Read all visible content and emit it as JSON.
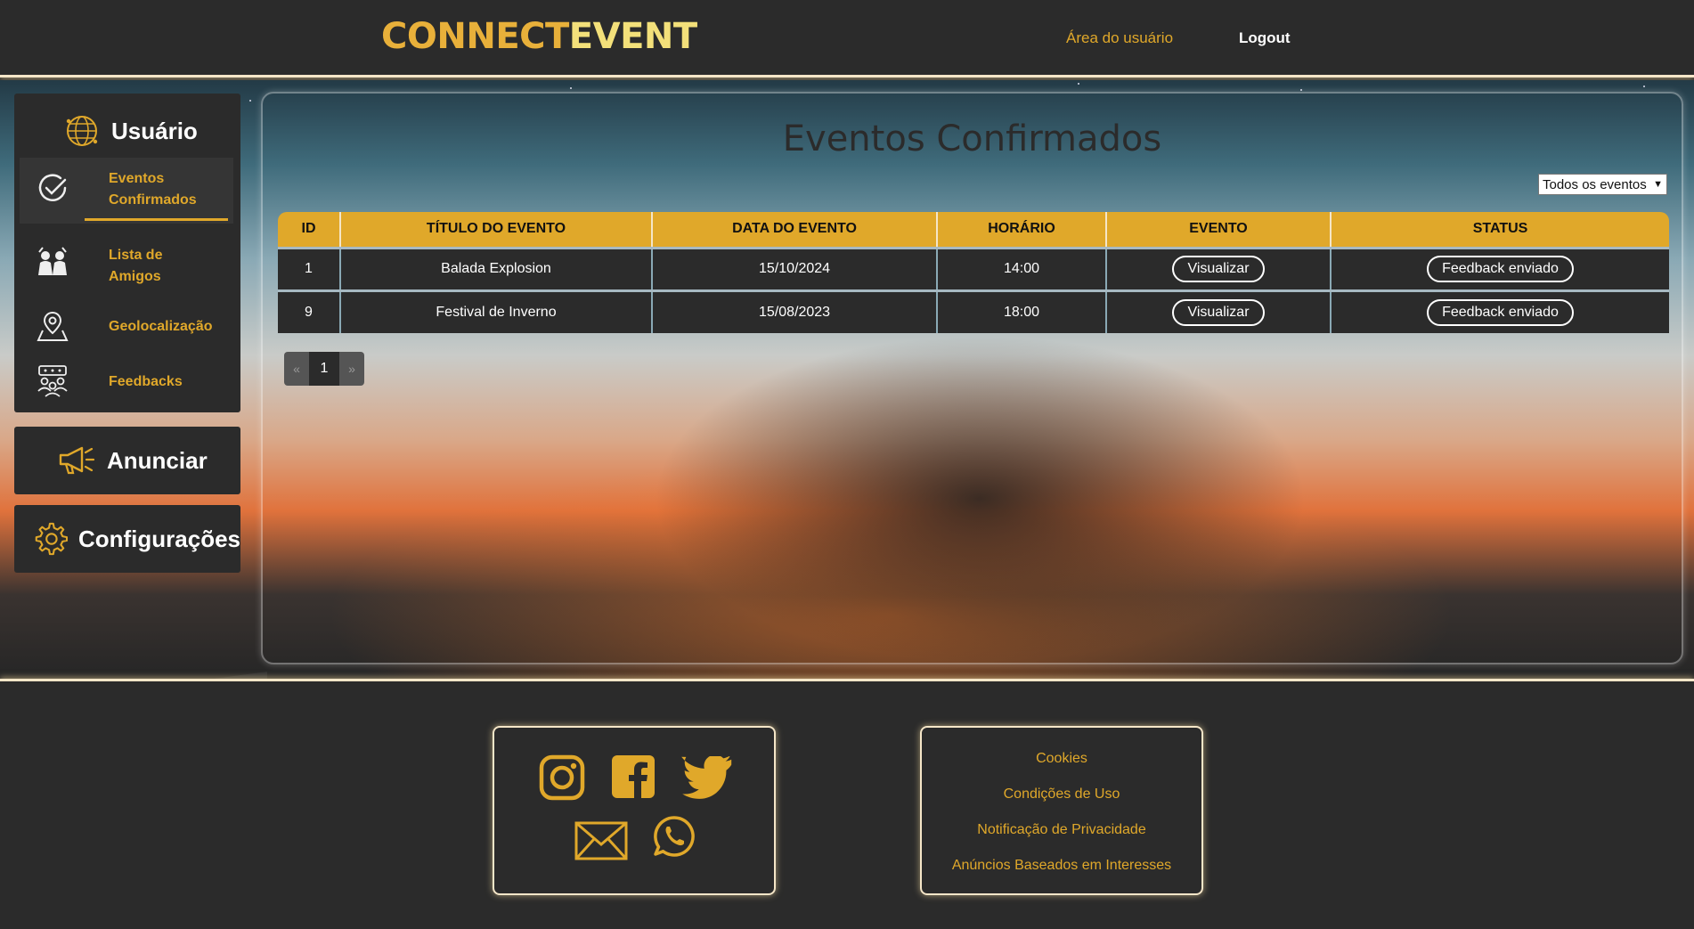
{
  "header": {
    "logo_part1": "CONNECT",
    "logo_part2": "EVENT",
    "user_area": "Área do usuário",
    "logout": "Logout"
  },
  "sidebar": {
    "user_title": "Usuário",
    "items": [
      {
        "line1": "Eventos",
        "line2": "Confirmados",
        "icon": "check-circle-icon"
      },
      {
        "line1": "Lista de",
        "line2": "Amigos",
        "icon": "friends-icon"
      },
      {
        "line1": "Geolocalização",
        "icon": "map-pin-icon"
      },
      {
        "line1": "Feedbacks",
        "icon": "people-feedback-icon"
      }
    ],
    "announce": "Anunciar",
    "settings": "Configurações"
  },
  "main": {
    "title": "Eventos Confirmados",
    "filter_selected": "Todos os eventos",
    "table": {
      "headers": [
        "ID",
        "Título do Evento",
        "Data do Evento",
        "Horário",
        "Evento",
        "Status"
      ],
      "rows": [
        {
          "id": "1",
          "title": "Balada Explosion",
          "date": "15/10/2024",
          "time": "14:00",
          "action": "Visualizar",
          "status": "Feedback enviado"
        },
        {
          "id": "9",
          "title": "Festival de Inverno",
          "date": "15/08/2023",
          "time": "18:00",
          "action": "Visualizar",
          "status": "Feedback enviado"
        }
      ]
    },
    "pagination": {
      "prev": "«",
      "current": "1",
      "next": "»"
    }
  },
  "footer": {
    "links": [
      "Cookies",
      "Condições de Uso",
      "Notificação de Privacidade",
      "Anúncios Baseados em Interesses"
    ]
  },
  "colors": {
    "accent": "#e0a82a",
    "dark": "#2b2b2b",
    "glow": "#f5e6c8"
  }
}
